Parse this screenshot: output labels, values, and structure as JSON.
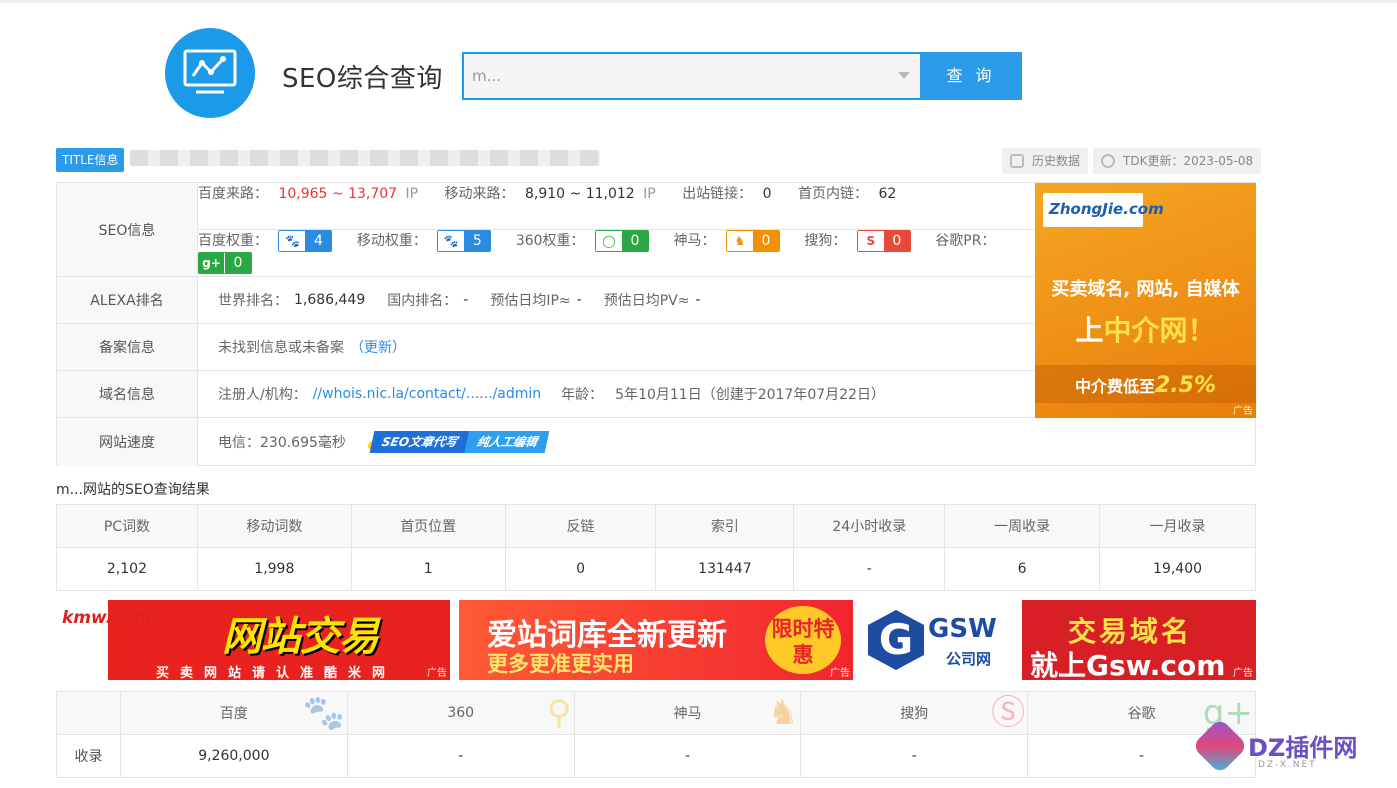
{
  "header": {
    "title": "SEO综合查询",
    "search_value": "m...",
    "search_button": "查 询"
  },
  "title_info": {
    "tag": "TITLE信息",
    "history_label": "历史数据",
    "tdk_label": "TDK更新：2023-05-08"
  },
  "seo_info": {
    "label": "SEO信息",
    "baidu_traffic_label": "百度来路：",
    "baidu_traffic_value": "10,965 ~ 13,707",
    "mobile_traffic_label": "移动来路：",
    "mobile_traffic_value": "8,910 ~ 11,012",
    "ip_unit": "IP",
    "outlinks_label": "出站链接：",
    "outlinks_value": "0",
    "homepage_links_label": "首页内链：",
    "homepage_links_value": "62",
    "weights": [
      {
        "label": "百度权重：",
        "value": "4",
        "icon": "paw-icon"
      },
      {
        "label": "移动权重：",
        "value": "5",
        "icon": "paw-icon"
      },
      {
        "label": "360权重：",
        "value": "0",
        "icon": "360-icon"
      },
      {
        "label": "神马：",
        "value": "0",
        "icon": "shenma-icon"
      },
      {
        "label": "搜狗：",
        "value": "0",
        "icon": "sogou-icon"
      },
      {
        "label": "谷歌PR：",
        "value": "0",
        "icon": "google-plus-icon"
      }
    ]
  },
  "alexa": {
    "label": "ALEXA排名",
    "world_label": "世界排名：",
    "world_value": "1,686,449",
    "domestic_label": "国内排名：",
    "domestic_value": "-",
    "daily_ip_label": "预估日均IP≈",
    "daily_ip_value": "-",
    "daily_pv_label": "预估日均PV≈",
    "daily_pv_value": "-"
  },
  "icp": {
    "label": "备案信息",
    "text": "未找到信息或未备案",
    "update_link": "（更新）"
  },
  "domain": {
    "label": "域名信息",
    "registrant_label": "注册人/机构：",
    "registrant_link": "//whois.nic.la/contact/....../admin",
    "age_label": "年龄：",
    "age_value": "5年10月11日（创建于2017年07月22日）"
  },
  "speed": {
    "label": "网站速度",
    "value": "电信：230.695毫秒",
    "ad_part1": "SEO文章代写",
    "ad_part2": "纯人工编辑"
  },
  "side_ad": {
    "brand": "ZhongJie.com",
    "line1": "买卖域名, 网站, 自媒体",
    "line2_prefix": "上",
    "line2_highlight": "中介网！",
    "line3_prefix": "中介费低至",
    "line3_highlight": "2.5%",
    "ad_mark": "广告"
  },
  "result_title": "m...网站的SEO查询结果",
  "stats": {
    "headers": [
      "PC词数",
      "移动词数",
      "首页位置",
      "反链",
      "索引",
      "24小时收录",
      "一周收录",
      "一月收录"
    ],
    "values": [
      "2,102",
      "1,998",
      "1",
      "0",
      "131447",
      "-",
      "6",
      "19,400"
    ]
  },
  "banners": {
    "b1": {
      "brand": "kmw.com",
      "big": "网站交易",
      "small": "买卖网站请认准酷米网",
      "ad_mark": "广告"
    },
    "b2": {
      "line1": "爱站词库全新更新",
      "line2": "更多更准更实用",
      "badge": "限时特惠",
      "ad_mark": "广告"
    },
    "b3": {
      "brand": "GSW",
      "brand_sub": "公司网",
      "line1": "交易域名",
      "line2": "就上Gsw.com",
      "ad_mark": "广告"
    }
  },
  "engines": {
    "headers": [
      "百度",
      "360",
      "神马",
      "搜狗",
      "谷歌"
    ],
    "row_label": "收录",
    "values": [
      "9,260,000",
      "-",
      "-",
      "-",
      "-"
    ]
  },
  "watermark": {
    "text": "DZ插件网",
    "url": "DZ-X.NET"
  }
}
